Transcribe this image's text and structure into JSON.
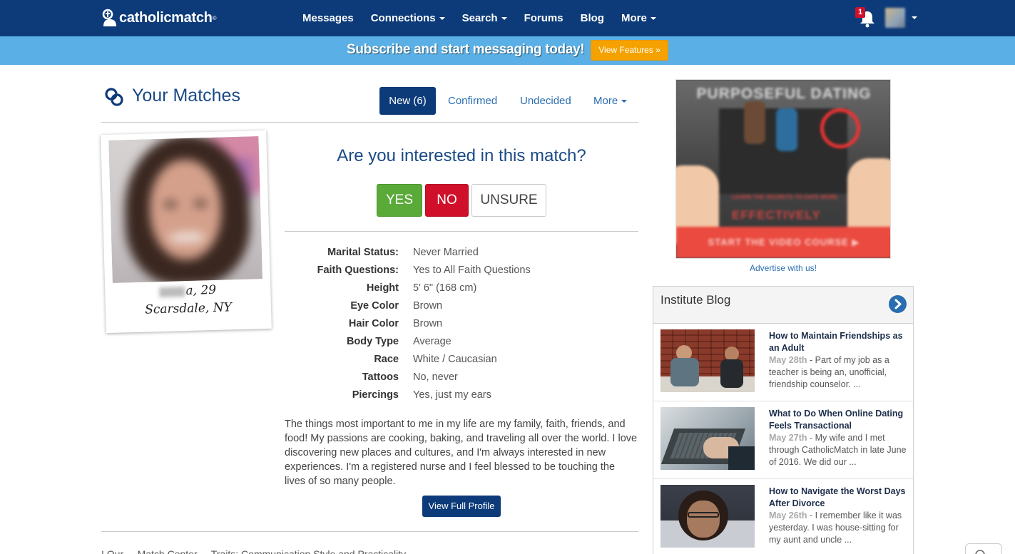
{
  "nav": {
    "logo": "catholicmatch",
    "logo_mark": "®",
    "links": [
      {
        "label": "Messages",
        "dropdown": false
      },
      {
        "label": "Connections",
        "dropdown": true
      },
      {
        "label": "Search",
        "dropdown": true
      },
      {
        "label": "Forums",
        "dropdown": false
      },
      {
        "label": "Blog",
        "dropdown": false
      },
      {
        "label": "More",
        "dropdown": true
      }
    ],
    "notification_count": "1",
    "icons": [
      "bell-icon",
      "avatar",
      "chevron-down-icon"
    ]
  },
  "banner": {
    "text": "Subscribe and start messaging today!",
    "button": "View Features »"
  },
  "matches": {
    "title": "Your Matches",
    "tabs": [
      "New (6)",
      "Confirmed",
      "Undecided",
      "More"
    ],
    "profile": {
      "name_suffix": "a, 29",
      "location": "Scarsdale, NY"
    },
    "question": "Are you interested in this match?",
    "buttons": {
      "yes": "YES",
      "no": "NO",
      "unsure": "UNSURE"
    },
    "details": [
      {
        "label": "Marital Status:",
        "value": "Never Married"
      },
      {
        "label": "Faith Questions:",
        "value": "Yes to All Faith Questions"
      },
      {
        "label": "Height",
        "value": "5' 6\" (168 cm)"
      },
      {
        "label": "Eye Color",
        "value": "Brown"
      },
      {
        "label": "Hair Color",
        "value": "Brown"
      },
      {
        "label": "Body Type",
        "value": "Average"
      },
      {
        "label": "Race",
        "value": "White / Caucasian"
      },
      {
        "label": "Tattoos",
        "value": "No, never"
      },
      {
        "label": "Piercings",
        "value": "Yes, just my ears"
      }
    ],
    "bio": "The things most important to me in my life are my family, faith, friends, and food! My passions are cooking, baking, and traveling all over the world. I love discovering new places and cultures, and I'm always interested in new experiences. I'm a registered nurse and I feel blessed to be touching the lives of so many people.",
    "profile_button": "View Full Profile",
    "bottom_text": "! Our  ...   Match Center   ...   Traits: Communication Style and Practicality"
  },
  "ad": {
    "title": "PURPOSEFUL DATING",
    "mid": "LEARN THE SECRETS TO DATE MORE",
    "big": "EFFECTIVELY",
    "cta": "START THE VIDEO COURSE ▶",
    "advertise_link": "Advertise with us!"
  },
  "blog": {
    "title": "Institute Blog",
    "items": [
      {
        "title": "How to Maintain Friendships as an Adult",
        "date": "May 28th",
        "excerpt": " - Part of my job as a teacher is being an, unofficial, friendship counselor. ..."
      },
      {
        "title": "What to Do When Online Dating Feels Transactional",
        "date": "May 27th",
        "excerpt": " - My wife and I met through CatholicMatch in late June of 2016. We did our ..."
      },
      {
        "title": "How to Navigate the Worst Days After Divorce",
        "date": "May 26th",
        "excerpt": " - I remember like it was yesterday. I was house-sitting for my aunt and uncle ..."
      }
    ]
  },
  "colors": {
    "nav_bg": "#0d3b7a",
    "banner_bg": "#5ab0e6",
    "accent_orange": "#f5a200",
    "yes_green": "#5aaa3a",
    "no_red": "#d0102a",
    "link_blue": "#2a6db0"
  }
}
